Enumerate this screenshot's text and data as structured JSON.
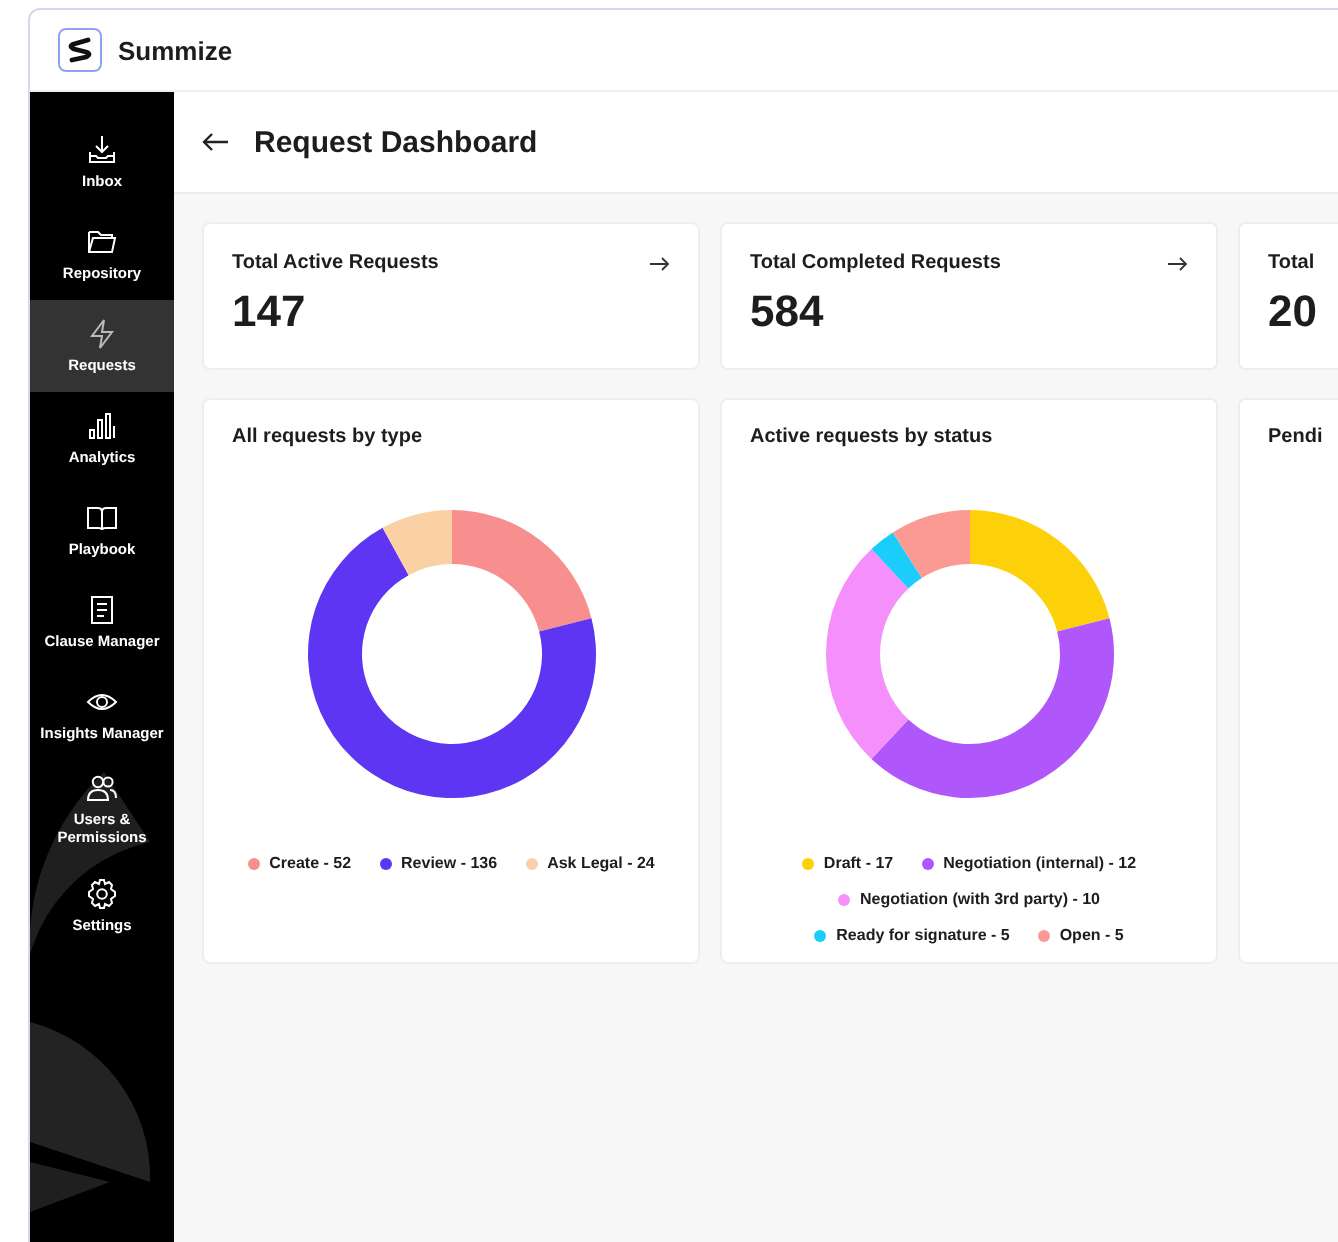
{
  "app": {
    "name": "Summize"
  },
  "sidebar": {
    "items": [
      {
        "label": "Inbox",
        "selected": false
      },
      {
        "label": "Repository",
        "selected": false
      },
      {
        "label": "Requests",
        "selected": true
      },
      {
        "label": "Analytics",
        "selected": false
      },
      {
        "label": "Playbook",
        "selected": false
      },
      {
        "label": "Clause Manager",
        "selected": false
      },
      {
        "label": "Insights Manager",
        "selected": false
      },
      {
        "label": "Users & Permissions",
        "selected": false
      },
      {
        "label": "Settings",
        "selected": false
      }
    ]
  },
  "page": {
    "title": "Request Dashboard"
  },
  "stats": [
    {
      "label": "Total Active Requests",
      "value": "147"
    },
    {
      "label": "Total Completed Requests",
      "value": "584"
    },
    {
      "label": "Total",
      "value": "20"
    }
  ],
  "charts": [
    {
      "title": "All requests by type",
      "legend": [
        {
          "color": "#f78f8f"
        },
        {
          "color": "#5e35f2"
        },
        {
          "color": "#fad1a5"
        }
      ],
      "chart_data": {
        "type": "donut",
        "categories": [
          "Create - 52",
          "Review - 136",
          "Ask Legal - 24"
        ],
        "values": [
          21,
          71,
          8
        ]
      }
    },
    {
      "title": "Active requests by status",
      "legend": [
        {
          "color": "#fdd10a"
        },
        {
          "color": "#b057fb"
        },
        {
          "color": "#f58ffb"
        },
        {
          "color": "#1bcdfb"
        },
        {
          "color": "#fb9a93"
        }
      ],
      "chart_data": {
        "type": "donut",
        "categories": [
          "Draft - 17",
          "Negotiation (internal) - 12",
          "Negotiation (with 3rd party) - 10",
          "Ready for signature - 5",
          "Open - 5"
        ],
        "values": [
          21,
          41,
          26,
          3,
          9
        ]
      }
    },
    {
      "title": "Pendi"
    }
  ]
}
